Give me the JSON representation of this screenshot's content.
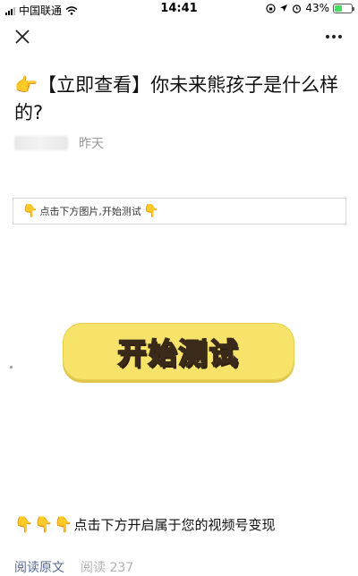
{
  "status_bar": {
    "carrier": "中国联通",
    "time": "14:41",
    "battery_percent": "43%",
    "battery_level": 0.43
  },
  "nav": {
    "close_icon": "close-icon",
    "more_icon": "more-dots-icon"
  },
  "article": {
    "title_emoji": "👉",
    "title": "【立即查看】你未来熊孩子是什么样的?",
    "date": "昨天"
  },
  "hint": {
    "text": "点击下方图片,开始测试"
  },
  "start_button": {
    "label": "开始测试"
  },
  "promo": {
    "text": "点击下方开启属于您的视频号变现"
  },
  "footer": {
    "read_original": "阅读原文",
    "read_count": "阅读 237"
  },
  "colors": {
    "button_yellow": "#f7e36a",
    "link_blue": "#576b95",
    "muted_gray": "#999999"
  }
}
